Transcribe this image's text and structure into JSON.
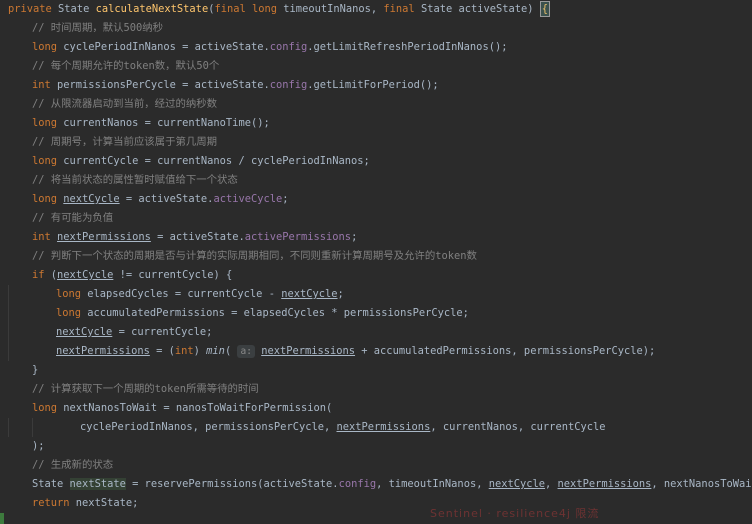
{
  "editor": {
    "lines": [
      [
        [
          "kw",
          "private "
        ],
        [
          "pl",
          "State "
        ],
        [
          "fn",
          "calculateNextState"
        ],
        [
          "pl",
          "("
        ],
        [
          "kw",
          "final long "
        ],
        [
          "pl",
          "timeoutInNanos, "
        ],
        [
          "kw",
          "final "
        ],
        [
          "pl",
          "State activeState) "
        ],
        [
          "brace",
          "{"
        ]
      ],
      [
        [
          "cmt",
          "// 时间周期，默认500纳秒"
        ]
      ],
      [
        [
          "kw",
          "long "
        ],
        [
          "pl",
          "cyclePeriodInNanos = activeState."
        ],
        [
          "field",
          "config"
        ],
        [
          "pl",
          ".getLimitRefreshPeriodInNanos();"
        ]
      ],
      [
        [
          "cmt",
          "// 每个周期允许的token数，默认50个"
        ]
      ],
      [
        [
          "kw",
          "int "
        ],
        [
          "pl",
          "permissionsPerCycle = activeState."
        ],
        [
          "field",
          "config"
        ],
        [
          "pl",
          ".getLimitForPeriod();"
        ]
      ],
      [
        [
          "cmt",
          "// 从限流器启动到当前，经过的纳秒数"
        ]
      ],
      [
        [
          "kw",
          "long "
        ],
        [
          "pl",
          "currentNanos = currentNanoTime();"
        ]
      ],
      [
        [
          "cmt",
          "// 周期号，计算当前应该属于第几周期"
        ]
      ],
      [
        [
          "kw",
          "long "
        ],
        [
          "pl",
          "currentCycle = currentNanos / cyclePeriodInNanos;"
        ]
      ],
      [
        [
          "cmt",
          "// 将当前状态的属性暂时赋值给下一个状态"
        ]
      ],
      [
        [
          "kw",
          "long "
        ],
        [
          "ul",
          "nextCycle"
        ],
        [
          "pl",
          " = activeState."
        ],
        [
          "field",
          "activeCycle"
        ],
        [
          "pl",
          ";"
        ]
      ],
      [
        [
          "cmt",
          "// 有可能为负值"
        ]
      ],
      [
        [
          "kw",
          "int "
        ],
        [
          "ul",
          "nextPermissions"
        ],
        [
          "pl",
          " = activeState."
        ],
        [
          "field",
          "activePermissions"
        ],
        [
          "pl",
          ";"
        ]
      ],
      [
        [
          "cmt",
          "// 判断下一个状态的周期是否与计算的实际周期相同，不同则重新计算周期号及允许的token数"
        ]
      ],
      [
        [
          "kw",
          "if "
        ],
        [
          "pl",
          "("
        ],
        [
          "ul",
          "nextCycle"
        ],
        [
          "pl",
          " != currentCycle) {"
        ]
      ],
      [
        [
          "kw",
          "long "
        ],
        [
          "pl",
          "elapsedCycles = currentCycle - "
        ],
        [
          "ul",
          "nextCycle"
        ],
        [
          "pl",
          ";"
        ]
      ],
      [
        [
          "kw",
          "long "
        ],
        [
          "pl",
          "accumulatedPermissions = elapsedCycles * permissionsPerCycle;"
        ]
      ],
      [
        [
          "ul",
          "nextCycle"
        ],
        [
          "pl",
          " = currentCycle;"
        ]
      ],
      [
        [
          "ul",
          "nextPermissions"
        ],
        [
          "pl",
          " = ("
        ],
        [
          "kw",
          "int"
        ],
        [
          "pl",
          ") "
        ],
        [
          "ital",
          "min"
        ],
        [
          "pl",
          "( "
        ],
        [
          "hint",
          "a:"
        ],
        [
          "pl",
          " "
        ],
        [
          "ul",
          "nextPermissions"
        ],
        [
          "pl",
          " + accumulatedPermissions, permissionsPerCycle);"
        ]
      ],
      [
        [
          "pl",
          "}"
        ]
      ],
      [
        [
          "cmt",
          "// 计算获取下一个周期的token所需等待的时间"
        ]
      ],
      [
        [
          "kw",
          "long "
        ],
        [
          "pl",
          "nextNanosToWait = nanosToWaitForPermission("
        ]
      ],
      [
        [
          "pl",
          "cyclePeriodInNanos, permissionsPerCycle, "
        ],
        [
          "ul",
          "nextPermissions"
        ],
        [
          "pl",
          ", currentNanos, currentCycle"
        ]
      ],
      [
        [
          "pl",
          ");"
        ]
      ],
      [
        [
          "cmt",
          "// 生成新的状态"
        ]
      ],
      [
        [
          "pl",
          "State "
        ],
        [
          "boxed",
          "nextState"
        ],
        [
          "pl",
          " = reservePermissions(activeState."
        ],
        [
          "field",
          "config"
        ],
        [
          "pl",
          ", timeoutInNanos, "
        ],
        [
          "ul",
          "nextCycle"
        ],
        [
          "pl",
          ", "
        ],
        [
          "ul",
          "nextPermissions"
        ],
        [
          "pl",
          ", nextNanosToWait);"
        ]
      ],
      [
        [
          "kw",
          "return "
        ],
        [
          "pl",
          "nextState;"
        ]
      ]
    ]
  },
  "watermarks": {
    "top": "",
    "bottom": "Sentinel  ·  resilience4j  限流"
  }
}
